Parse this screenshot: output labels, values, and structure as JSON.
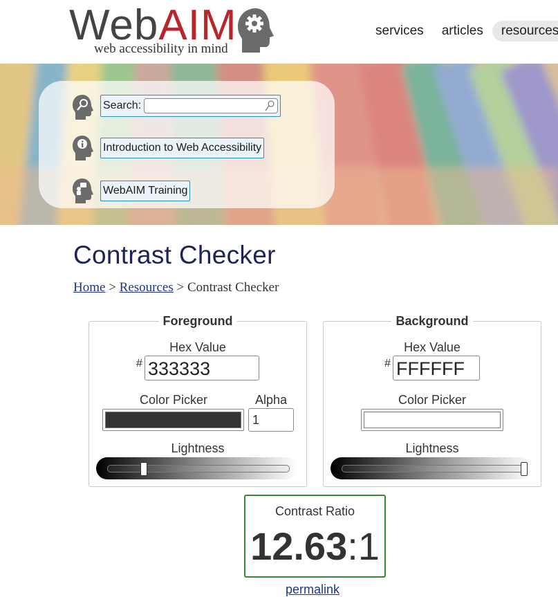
{
  "header": {
    "logo_web": "Web",
    "logo_aim": "AIM",
    "logo_tagline": "web accessibility in mind",
    "logo_icon": "gear-head-icon",
    "nav": [
      {
        "label": "services",
        "active": false
      },
      {
        "label": "articles",
        "active": false
      },
      {
        "label": "resources",
        "active": true
      }
    ]
  },
  "quick_links": {
    "search_label": "Search:",
    "search_placeholder": "",
    "search_icon": "magnifier-icon",
    "intro_label": "Introduction to Web Accessibility",
    "intro_icon": "info-head-icon",
    "training_label": "WebAIM Training",
    "training_icon": "training-head-icon"
  },
  "page": {
    "title": "Contrast Checker",
    "breadcrumb": {
      "home": "Home",
      "sep1": " > ",
      "resources": "Resources",
      "sep2": " > ",
      "current": "Contrast Checker"
    }
  },
  "foreground": {
    "legend": "Foreground",
    "hex_label": "Hex Value",
    "hash": "#",
    "hex_value": "333333",
    "picker_label": "Color Picker",
    "picker_color": "#333333",
    "alpha_label": "Alpha",
    "alpha_value": "1",
    "lightness_label": "Lightness",
    "lightness_percent": 20
  },
  "background": {
    "legend": "Background",
    "hex_label": "Hex Value",
    "hash": "#",
    "hex_value": "FFFFFF",
    "picker_label": "Color Picker",
    "picker_color": "#FFFFFF",
    "lightness_label": "Lightness",
    "lightness_percent": 100
  },
  "result": {
    "label": "Contrast Ratio",
    "ratio": "12.63",
    "suffix": ":1",
    "permalink": "permalink",
    "border_color": "#2f8a30"
  },
  "colors": {
    "title": "#1e2556",
    "link": "#22348a",
    "brand_red": "#b8252a"
  }
}
